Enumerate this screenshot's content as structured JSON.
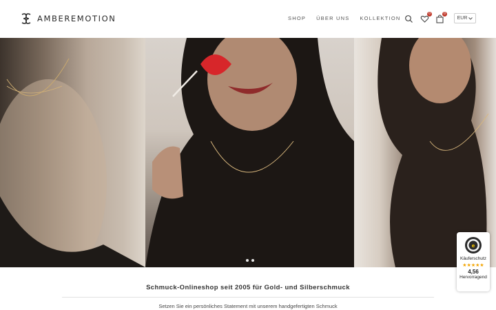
{
  "header": {
    "brand": "AMBEREMOTION",
    "nav": [
      {
        "label": "SHOP"
      },
      {
        "label": "ÜBER UNS"
      },
      {
        "label": "KOLLEKTION"
      }
    ],
    "wishlist_count": "0",
    "cart_count": "0",
    "currency": "EUR"
  },
  "hero": {
    "slides": 2,
    "active_slide": 1
  },
  "intro": {
    "tagline": "Schmuck-Onlineshop seit 2005 für Gold- und Silberschmuck",
    "subline": "Setzen Sie ein persönliches Statement mit unserem handgefertigten Schmuck"
  },
  "trust_badge": {
    "label": "Käuferschutz",
    "score": "4,56",
    "rating_word": "Hervorragend",
    "stars": "★★★★★"
  },
  "colors": {
    "accent": "#c0392b",
    "star": "#f2a400",
    "text": "#333333"
  }
}
